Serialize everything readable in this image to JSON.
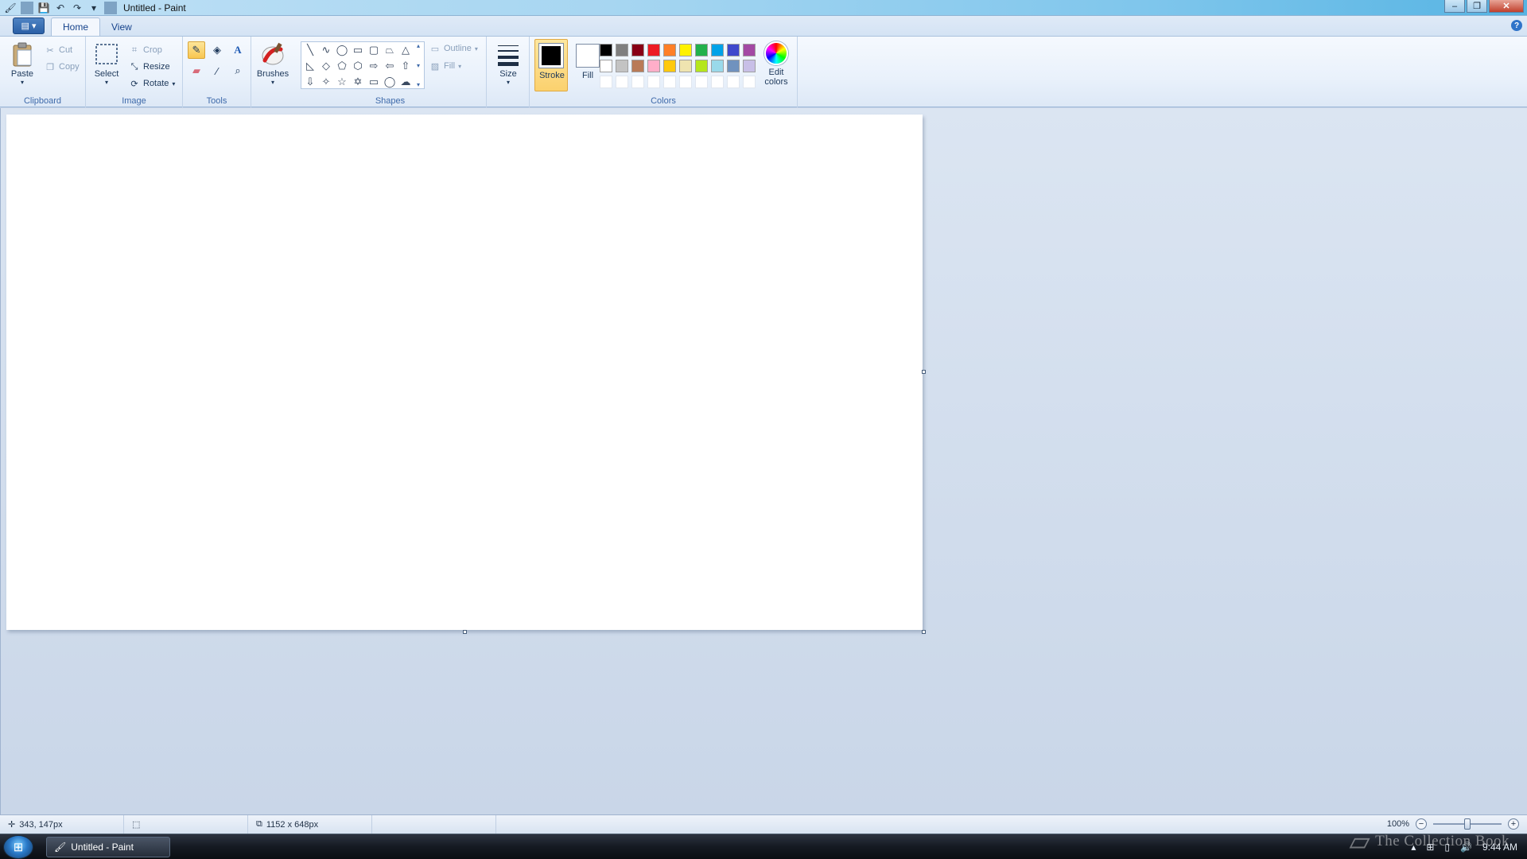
{
  "window": {
    "title": "Untitled - Paint"
  },
  "qat": {
    "save": "💾",
    "undo": "↶",
    "redo": "↷",
    "customize": "▾"
  },
  "tabs": {
    "home": "Home",
    "view": "View"
  },
  "ribbon": {
    "clipboard": {
      "label": "Clipboard",
      "paste": "Paste",
      "cut": "Cut",
      "copy": "Copy"
    },
    "image": {
      "label": "Image",
      "select": "Select",
      "crop": "Crop",
      "resize": "Resize",
      "rotate": "Rotate"
    },
    "tools": {
      "label": "Tools"
    },
    "brushes": {
      "label": "Brushes"
    },
    "shapes": {
      "label": "Shapes",
      "outline": "Outline",
      "fill": "Fill"
    },
    "size": {
      "label": "Size"
    },
    "colors": {
      "label": "Colors",
      "stroke": "Stroke",
      "fill": "Fill",
      "edit": "Edit colors",
      "stroke_color": "#000000",
      "fill_color": "#ffffff",
      "palette_row1": [
        "#000000",
        "#7f7f7f",
        "#880015",
        "#ed1c24",
        "#ff7f27",
        "#fff200",
        "#22b14c",
        "#00a2e8",
        "#3f48cc",
        "#a349a4"
      ],
      "palette_row2": [
        "#ffffff",
        "#c3c3c3",
        "#b97a57",
        "#ffaec9",
        "#ffc90e",
        "#efe4b0",
        "#b5e61d",
        "#99d9ea",
        "#7092be",
        "#c8bfe7"
      ]
    }
  },
  "status": {
    "cursor_pos": "343, 147px",
    "canvas_size": "1152 x 648px",
    "zoom_label": "100%",
    "zoom_fraction": 0.5
  },
  "taskbar": {
    "task": "Untitled - Paint",
    "clock": "9:44 AM"
  },
  "watermark": "The Collection Book"
}
